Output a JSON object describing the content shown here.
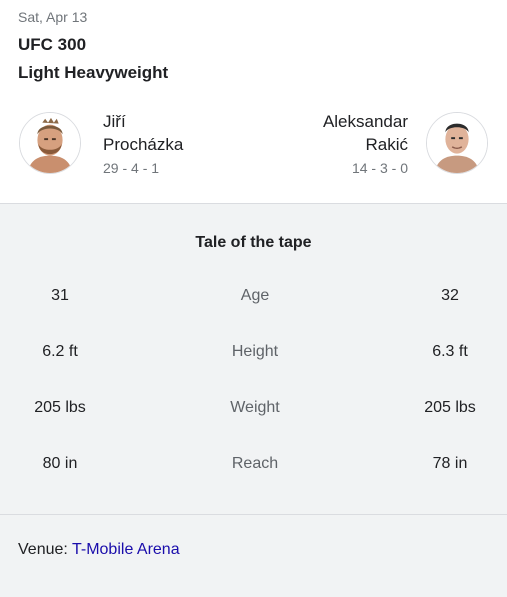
{
  "header": {
    "date": "Sat, Apr 13",
    "event": "UFC 300",
    "division": "Light Heavyweight"
  },
  "fighters": {
    "left": {
      "first_name": "Jiří",
      "last_name": "Procházka",
      "record": "29 - 4 - 1"
    },
    "right": {
      "first_name": "Aleksandar",
      "last_name": "Rakić",
      "record": "14 - 3 - 0"
    }
  },
  "tape": {
    "title": "Tale of the tape",
    "rows": [
      {
        "label": "Age",
        "left": "31",
        "right": "32"
      },
      {
        "label": "Height",
        "left": "6.2 ft",
        "right": "6.3 ft"
      },
      {
        "label": "Weight",
        "left": "205 lbs",
        "right": "205 lbs"
      },
      {
        "label": "Reach",
        "left": "80 in",
        "right": "78 in"
      }
    ]
  },
  "venue": {
    "label": "Venue:",
    "name": "T-Mobile Arena"
  },
  "colors": {
    "link": "#1a0dab",
    "muted": "#70757a",
    "panel": "#f1f3f4"
  }
}
